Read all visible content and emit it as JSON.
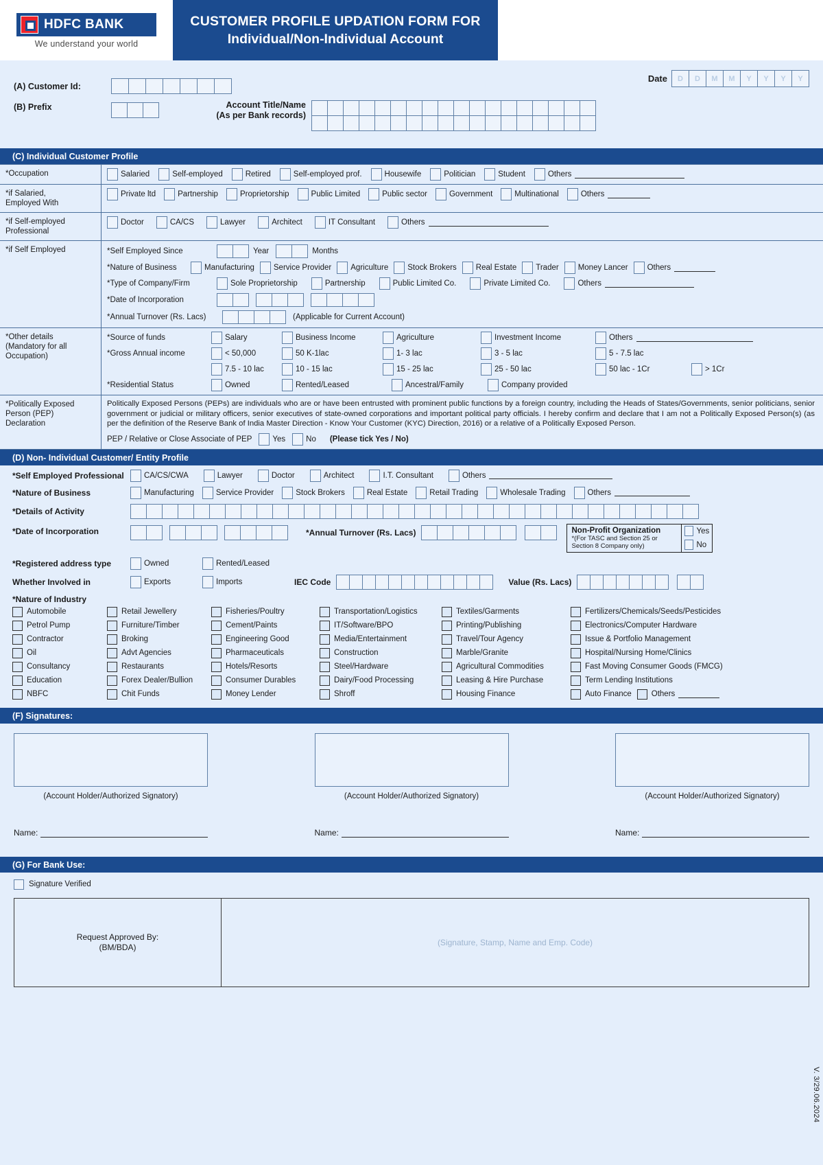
{
  "header": {
    "bank_name": "HDFC BANK",
    "tagline": "We understand your world",
    "title_line1": "CUSTOMER PROFILE UPDATION FORM FOR",
    "title_line2": "Individual/Non-Individual Account"
  },
  "top": {
    "date_label": "Date",
    "date_placeholders": [
      "D",
      "D",
      "M",
      "M",
      "Y",
      "Y",
      "Y",
      "Y"
    ],
    "customer_id_label": "(A) Customer Id:",
    "customer_id_cells": 7,
    "prefix_label": "(B) Prefix",
    "prefix_cells": 3,
    "account_title_label_line1": "Account Title/Name",
    "account_title_label_line2": "(As per Bank records)",
    "account_title_cells": 18
  },
  "section_c": {
    "banner": "(C) Individual Customer Profile",
    "occupation": {
      "label": "*Occupation",
      "options": [
        "Salaried",
        "Self-employed",
        "Retired",
        "Self-employed prof.",
        "Housewife",
        "Politician",
        "Student"
      ],
      "others_label": "Others"
    },
    "if_salaried": {
      "label": "*if Salaried,\nEmployed With",
      "label_line1": "*if Salaried,",
      "label_line2": "Employed With",
      "options": [
        "Private ltd",
        "Partnership",
        "Proprietorship",
        "Public Limited",
        "Public sector",
        "Government",
        "Multinational"
      ],
      "others_label": "Others"
    },
    "if_self_employed_prof": {
      "label_line1": "*if Self-employed",
      "label_line2": "Professional",
      "options": [
        "Doctor",
        "CA/CS",
        "Lawyer",
        "Architect",
        "IT Consultant"
      ],
      "others_label": "Others"
    },
    "if_self_employed": {
      "label": "*if Self Employed",
      "since_label": "*Self Employed Since",
      "year_label": "Year",
      "months_label": "Months",
      "nature_label": "*Nature of Business",
      "nature_options": [
        "Manufacturing",
        "Service Provider",
        "Agriculture",
        "Stock Brokers",
        "Real Estate",
        "Trader",
        "Money Lancer"
      ],
      "nature_others": "Others",
      "type_label": "*Type of Company/Firm",
      "type_options": [
        "Sole Proprietorship",
        "Partnership",
        "Public Limited Co.",
        "Private Limited Co."
      ],
      "type_others": "Others",
      "doi_label": "*Date of Incorporation",
      "turnover_label": "*Annual Turnover (Rs. Lacs)",
      "turnover_note": "(Applicable for Current Account)"
    },
    "other_details": {
      "label_line1": "*Other details",
      "label_line2": "(Mandatory for all",
      "label_line3": "Occupation)",
      "source_label": "*Source of funds",
      "source_options": [
        "Salary",
        "Business Income",
        "Agriculture",
        "Investment Income"
      ],
      "source_others": "Others",
      "gross_label": "*Gross Annual income",
      "gross_row1": [
        "< 50,000",
        "50 K-1lac",
        "1- 3 lac",
        "3 - 5 lac",
        "5 - 7.5 lac"
      ],
      "gross_row2": [
        "7.5 - 10 lac",
        "10 - 15 lac",
        "15 - 25 lac",
        "25 - 50 lac",
        "50 lac - 1Cr",
        "> 1Cr"
      ],
      "residential_label": "*Residential Status",
      "residential_options": [
        "Owned",
        "Rented/Leased",
        "Ancestral/Family",
        "Company provided"
      ]
    },
    "pep": {
      "label_line1": "*Politically Exposed",
      "label_line2": "Person (PEP)",
      "label_line3": "Declaration",
      "paragraph": "Politically Exposed Persons (PEPs) are individuals who are or have been entrusted with prominent public functions by a foreign country, including the Heads of States/Governments, senior politicians, senior government or judicial or military officers, senior executives of state-owned corporations and important political party officials. I hereby confirm and declare that I am not a Politically Exposed Person(s) (as per the definition of the Reserve Bank of India Master Direction - Know Your Customer (KYC) Direction, 2016) or a relative of a Politically Exposed Person.",
      "tick_label": "PEP / Relative or Close Associate of PEP",
      "yes_label": "Yes",
      "no_label": "No",
      "instruction": "(Please tick Yes / No)"
    }
  },
  "section_d": {
    "banner": "(D) Non- Individual Customer/ Entity Profile",
    "self_employed_prof": {
      "label": "*Self Employed Professional",
      "options": [
        "CA/CS/CWA",
        "Lawyer",
        "Doctor",
        "Architect",
        "I.T. Consultant"
      ],
      "others_label": "Others"
    },
    "nature_of_business": {
      "label": "*Nature of Business",
      "options": [
        "Manufacturing",
        "Service Provider",
        "Stock Brokers",
        "Real Estate",
        "Retail Trading",
        "Wholesale Trading"
      ],
      "others_label": "Others"
    },
    "details_of_activity": {
      "label": "*Details of Activity",
      "cells": 36
    },
    "date_of_incorporation": {
      "label": "*Date of Incorporation"
    },
    "annual_turnover": {
      "label": "*Annual Turnover (Rs. Lacs)"
    },
    "non_profit": {
      "title": "Non-Profit Organization",
      "note_line1": "*(For TASC and Section 25 or",
      "note_line2": "Section 8 Company only)",
      "yes_label": "Yes",
      "no_label": "No"
    },
    "registered_address_type": {
      "label": "*Registered address type",
      "options": [
        "Owned",
        "Rented/Leased"
      ]
    },
    "whether_involved_in": {
      "label": "Whether Involved in",
      "options": [
        "Exports",
        "Imports"
      ],
      "iec_label": "IEC Code",
      "iec_cells": 12,
      "value_label": "Value (Rs. Lacs)",
      "value_cells": 7
    },
    "nature_of_industry": {
      "label": "*Nature of Industry",
      "columns": [
        [
          "Automobile",
          "Petrol Pump",
          "Contractor",
          "Oil",
          "Consultancy",
          "Education",
          "NBFC"
        ],
        [
          "Retail Jewellery",
          "Furniture/Timber",
          "Broking",
          "Advt Agencies",
          "Restaurants",
          "Forex Dealer/Bullion",
          "Chit Funds"
        ],
        [
          "Fisheries/Poultry",
          "Cement/Paints",
          "Engineering Good",
          "Pharmaceuticals",
          "Hotels/Resorts",
          "Consumer Durables",
          "Money Lender"
        ],
        [
          "Transportation/Logistics",
          "IT/Software/BPO",
          "Media/Entertainment",
          "Construction",
          "Steel/Hardware",
          "Dairy/Food Processing",
          "Shroff"
        ],
        [
          "Textiles/Garments",
          "Printing/Publishing",
          "Travel/Tour Agency",
          "Marble/Granite",
          "Agricultural Commodities",
          "Leasing & Hire Purchase",
          "Housing Finance"
        ],
        [
          "Fertilizers/Chemicals/Seeds/Pesticides",
          "Electronics/Computer Hardware",
          "Issue & Portfolio Management",
          "Hospital/Nursing Home/Clinics",
          "Fast Moving Consumer Goods (FMCG)",
          "Term Lending Institutions",
          "Auto Finance"
        ]
      ],
      "last_others": "Others"
    }
  },
  "section_f": {
    "banner": "(F) Signatures:",
    "caption": "(Account Holder/Authorized Signatory)",
    "name_label": "Name:"
  },
  "section_g": {
    "banner": "(G) For Bank Use:",
    "signature_verified": "Signature Verified",
    "approved_line1": "Request Approved By:",
    "approved_line2": "(BM/BDA)",
    "stamp_text": "(Signature, Stamp, Name and Emp. Code)"
  },
  "version": "V. 3/29.06.2024",
  "colors": {
    "brand_blue": "#1b4b8f",
    "page_bg": "#e4eefb",
    "logo_red": "#ed232a"
  }
}
